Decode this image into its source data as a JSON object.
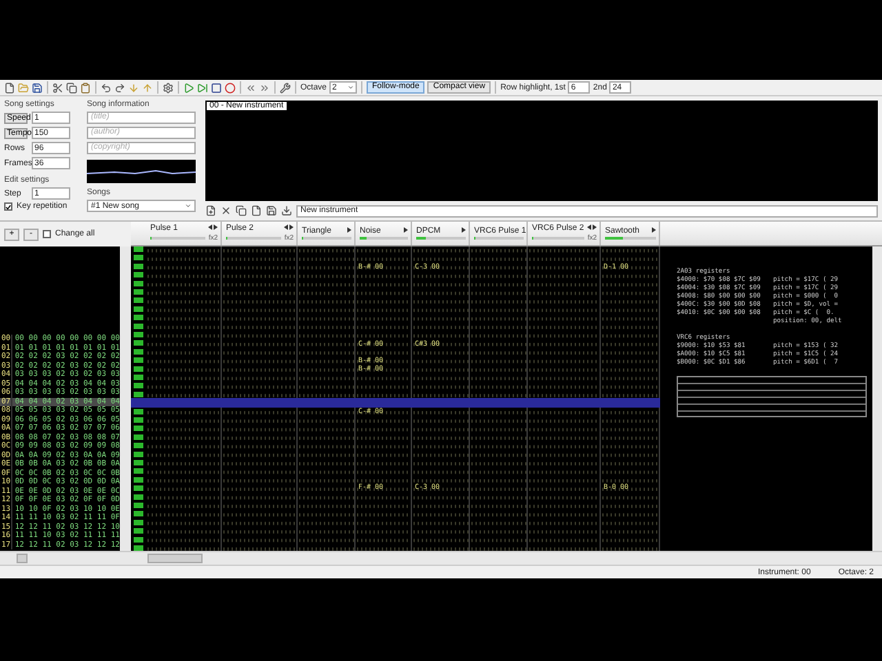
{
  "toolbar": {
    "octave_label": "Octave",
    "octave": "2",
    "follow_mode": {
      "label": "Follow-mode",
      "on": true
    },
    "compact_view": {
      "label": "Compact view",
      "on": false
    },
    "row_highlight_label": "Row highlight, 1st",
    "row_highlight_1st": "6",
    "second_label": "2nd",
    "row_highlight_2nd": "24"
  },
  "song_settings": {
    "title": "Song settings",
    "fields": [
      {
        "label": "Speed",
        "value": "1",
        "kind": "button"
      },
      {
        "label": "Tempo",
        "value": "150",
        "kind": "button"
      },
      {
        "label": "Rows",
        "value": "96",
        "kind": "plain"
      },
      {
        "label": "Frames",
        "value": "36",
        "kind": "plain"
      }
    ]
  },
  "edit_settings": {
    "title": "Edit settings",
    "step_label": "Step",
    "step": "1",
    "key_repetition": {
      "label": "Key repetition",
      "checked": true
    }
  },
  "song_information": {
    "title": "Song information",
    "fields": [
      {
        "placeholder": "(title)"
      },
      {
        "placeholder": "(author)"
      },
      {
        "placeholder": "(copyright)"
      }
    ]
  },
  "songs": {
    "label": "Songs",
    "value": "#1 New song"
  },
  "instruments": {
    "items": [
      {
        "label": "00 - New instrument",
        "selected": true
      }
    ],
    "name": "New instrument"
  },
  "frames": {
    "add": "+",
    "remove": "-",
    "change_all": {
      "label": "Change all",
      "checked": false
    },
    "rows": [
      {
        "label": "00",
        "values": [
          "00",
          "00",
          "00",
          "00",
          "00",
          "00",
          "00",
          "00"
        ],
        "selected": false
      },
      {
        "label": "01",
        "values": [
          "01",
          "01",
          "01",
          "01",
          "01",
          "01",
          "01",
          "01"
        ],
        "selected": false
      },
      {
        "label": "02",
        "values": [
          "02",
          "02",
          "02",
          "03",
          "02",
          "02",
          "02",
          "02"
        ],
        "selected": false
      },
      {
        "label": "03",
        "values": [
          "02",
          "02",
          "02",
          "02",
          "03",
          "02",
          "02",
          "02"
        ],
        "selected": false
      },
      {
        "label": "04",
        "values": [
          "03",
          "03",
          "03",
          "02",
          "03",
          "02",
          "03",
          "03"
        ],
        "selected": false
      },
      {
        "label": "05",
        "values": [
          "04",
          "04",
          "04",
          "02",
          "03",
          "04",
          "04",
          "03"
        ],
        "selected": false
      },
      {
        "label": "06",
        "values": [
          "03",
          "03",
          "03",
          "03",
          "02",
          "03",
          "03",
          "03"
        ],
        "selected": false
      },
      {
        "label": "07",
        "values": [
          "04",
          "04",
          "04",
          "02",
          "03",
          "04",
          "04",
          "04"
        ],
        "selected": true
      },
      {
        "label": "08",
        "values": [
          "05",
          "05",
          "03",
          "03",
          "02",
          "05",
          "05",
          "05"
        ],
        "selected": false
      },
      {
        "label": "09",
        "values": [
          "06",
          "06",
          "05",
          "02",
          "03",
          "06",
          "06",
          "05"
        ],
        "selected": false
      },
      {
        "label": "0A",
        "values": [
          "07",
          "07",
          "06",
          "03",
          "02",
          "07",
          "07",
          "06"
        ],
        "selected": false
      },
      {
        "label": "0B",
        "values": [
          "08",
          "08",
          "07",
          "02",
          "03",
          "08",
          "08",
          "07"
        ],
        "selected": false
      },
      {
        "label": "0C",
        "values": [
          "09",
          "09",
          "08",
          "03",
          "02",
          "09",
          "09",
          "08"
        ],
        "selected": false
      },
      {
        "label": "0D",
        "values": [
          "0A",
          "0A",
          "09",
          "02",
          "03",
          "0A",
          "0A",
          "09"
        ],
        "selected": false
      },
      {
        "label": "0E",
        "values": [
          "0B",
          "0B",
          "0A",
          "03",
          "02",
          "0B",
          "0B",
          "0A"
        ],
        "selected": false
      },
      {
        "label": "0F",
        "values": [
          "0C",
          "0C",
          "0B",
          "02",
          "03",
          "0C",
          "0C",
          "0B"
        ],
        "selected": false
      },
      {
        "label": "10",
        "values": [
          "0D",
          "0D",
          "0C",
          "03",
          "02",
          "0D",
          "0D",
          "0A"
        ],
        "selected": false
      },
      {
        "label": "11",
        "values": [
          "0E",
          "0E",
          "0D",
          "02",
          "03",
          "0E",
          "0E",
          "0C"
        ],
        "selected": false
      },
      {
        "label": "12",
        "values": [
          "0F",
          "0F",
          "0E",
          "03",
          "02",
          "0F",
          "0F",
          "0D"
        ],
        "selected": false
      },
      {
        "label": "13",
        "values": [
          "10",
          "10",
          "0F",
          "02",
          "03",
          "10",
          "10",
          "0E"
        ],
        "selected": false
      },
      {
        "label": "14",
        "values": [
          "11",
          "11",
          "10",
          "03",
          "02",
          "11",
          "11",
          "0F"
        ],
        "selected": false
      },
      {
        "label": "15",
        "values": [
          "12",
          "12",
          "11",
          "02",
          "03",
          "12",
          "12",
          "10"
        ],
        "selected": false
      },
      {
        "label": "16",
        "values": [
          "11",
          "11",
          "10",
          "03",
          "02",
          "11",
          "11",
          "11"
        ],
        "selected": false
      },
      {
        "label": "17",
        "values": [
          "12",
          "12",
          "11",
          "02",
          "03",
          "12",
          "12",
          "12"
        ],
        "selected": false
      }
    ]
  },
  "channels": [
    {
      "name": "Pulse 1",
      "fx": "fx2",
      "level": 0
    },
    {
      "name": "Pulse 2",
      "fx": "fx2",
      "level": 0
    },
    {
      "name": "Triangle",
      "level": 0
    },
    {
      "name": "Noise",
      "level": 0.15
    },
    {
      "name": "DPCM",
      "level": 0.2
    },
    {
      "name": "VRC6 Pulse 1",
      "level": 0
    },
    {
      "name": "VRC6 Pulse 2",
      "fx": "fx2",
      "level": 0
    },
    {
      "name": "Sawtooth",
      "level": 0.35
    }
  ],
  "pattern_rows": [
    {
      "selected": false,
      "cells": [
        null,
        null,
        null,
        null,
        null,
        null,
        null,
        null
      ]
    },
    {
      "selected": false,
      "cells": [
        null,
        null,
        null,
        null,
        null,
        null,
        null,
        null
      ]
    },
    {
      "selected": false,
      "cells": [
        null,
        null,
        null,
        "B-# 00",
        "C-3 00",
        null,
        null,
        "D-1 00"
      ]
    },
    {
      "selected": false,
      "cells": [
        null,
        null,
        null,
        null,
        null,
        null,
        null,
        null
      ]
    },
    {
      "selected": false,
      "cells": [
        null,
        null,
        null,
        null,
        null,
        null,
        null,
        null
      ]
    },
    {
      "selected": false,
      "cells": [
        null,
        null,
        null,
        null,
        null,
        null,
        null,
        null
      ]
    },
    {
      "selected": false,
      "cells": [
        null,
        null,
        null,
        null,
        null,
        null,
        null,
        null
      ]
    },
    {
      "selected": false,
      "cells": [
        null,
        null,
        null,
        null,
        null,
        null,
        null,
        null
      ]
    },
    {
      "selected": false,
      "cells": [
        null,
        null,
        null,
        null,
        null,
        null,
        null,
        null
      ]
    },
    {
      "selected": false,
      "cells": [
        null,
        null,
        null,
        null,
        null,
        null,
        null,
        null
      ]
    },
    {
      "selected": false,
      "cells": [
        null,
        null,
        null,
        null,
        null,
        null,
        null,
        null
      ]
    },
    {
      "selected": false,
      "cells": [
        null,
        null,
        null,
        "C-# 00",
        "C#3 00",
        null,
        null,
        null
      ]
    },
    {
      "selected": false,
      "cells": [
        null,
        null,
        null,
        null,
        null,
        null,
        null,
        null
      ]
    },
    {
      "selected": false,
      "cells": [
        null,
        null,
        null,
        "B-# 00",
        null,
        null,
        null,
        null
      ]
    },
    {
      "selected": false,
      "cells": [
        null,
        null,
        null,
        "B-# 00",
        null,
        null,
        null,
        null
      ]
    },
    {
      "selected": false,
      "cells": [
        null,
        null,
        null,
        null,
        null,
        null,
        null,
        null
      ]
    },
    {
      "selected": false,
      "cells": [
        null,
        null,
        null,
        null,
        null,
        null,
        null,
        null
      ]
    },
    {
      "selected": false,
      "cells": [
        null,
        null,
        null,
        null,
        null,
        null,
        null,
        null
      ]
    },
    {
      "selected": true,
      "cells": [
        null,
        null,
        null,
        null,
        null,
        null,
        null,
        null
      ]
    },
    {
      "selected": false,
      "cells": [
        null,
        null,
        null,
        "C-# 00",
        null,
        null,
        null,
        null
      ]
    },
    {
      "selected": false,
      "cells": [
        null,
        null,
        null,
        null,
        null,
        null,
        null,
        null
      ]
    },
    {
      "selected": false,
      "cells": [
        null,
        null,
        null,
        null,
        null,
        null,
        null,
        null
      ]
    },
    {
      "selected": false,
      "cells": [
        null,
        null,
        null,
        null,
        null,
        null,
        null,
        null
      ]
    },
    {
      "selected": false,
      "cells": [
        null,
        null,
        null,
        null,
        null,
        null,
        null,
        null
      ]
    },
    {
      "selected": false,
      "cells": [
        null,
        null,
        null,
        null,
        null,
        null,
        null,
        null
      ]
    },
    {
      "selected": false,
      "cells": [
        null,
        null,
        null,
        null,
        null,
        null,
        null,
        null
      ]
    },
    {
      "selected": false,
      "cells": [
        null,
        null,
        null,
        null,
        null,
        null,
        null,
        null
      ]
    },
    {
      "selected": false,
      "cells": [
        null,
        null,
        null,
        null,
        null,
        null,
        null,
        null
      ]
    },
    {
      "selected": false,
      "cells": [
        null,
        null,
        null,
        "F-# 00",
        "C-3 00",
        null,
        null,
        "B-0 00"
      ]
    },
    {
      "selected": false,
      "cells": [
        null,
        null,
        null,
        null,
        null,
        null,
        null,
        null
      ]
    },
    {
      "selected": false,
      "cells": [
        null,
        null,
        null,
        null,
        null,
        null,
        null,
        null
      ]
    },
    {
      "selected": false,
      "cells": [
        null,
        null,
        null,
        null,
        null,
        null,
        null,
        null
      ]
    },
    {
      "selected": false,
      "cells": [
        null,
        null,
        null,
        null,
        null,
        null,
        null,
        null
      ]
    },
    {
      "selected": false,
      "cells": [
        null,
        null,
        null,
        null,
        null,
        null,
        null,
        null
      ]
    },
    {
      "selected": false,
      "cells": [
        null,
        null,
        null,
        null,
        null,
        null,
        null,
        null
      ]
    },
    {
      "selected": false,
      "cells": [
        null,
        null,
        null,
        null,
        null,
        null,
        null,
        null
      ]
    }
  ],
  "registers": [
    {
      "title": "2A03 registers",
      "lines": [
        {
          "bytes": "$4000: $70 $08 $7C $09",
          "info": "pitch = $17C ( 29"
        },
        {
          "bytes": "$4004: $30 $08 $7C $09",
          "info": "pitch = $17C ( 29"
        },
        {
          "bytes": "$4008: $80 $00 $00 $00",
          "info": "pitch = $000 (  0"
        },
        {
          "bytes": "$400C: $30 $00 $0D $08",
          "info": "pitch = $D, vol ="
        },
        {
          "bytes": "$4010: $0C $00 $00 $08",
          "info": "pitch = $C (  0."
        },
        {
          "info": "position: 00, delt"
        }
      ]
    },
    {
      "title": "VRC6 registers",
      "lines": [
        {
          "bytes": "$9000: $10 $53 $81",
          "info": "pitch = $153 ( 32"
        },
        {
          "bytes": "$A000: $10 $C5 $81",
          "info": "pitch = $1C5 ( 24"
        },
        {
          "bytes": "$B000: $0C $D1 $86",
          "info": "pitch = $6D1 (  7"
        }
      ]
    }
  ],
  "status_bar": [
    "Instrument: 00",
    "Octave: 2"
  ]
}
